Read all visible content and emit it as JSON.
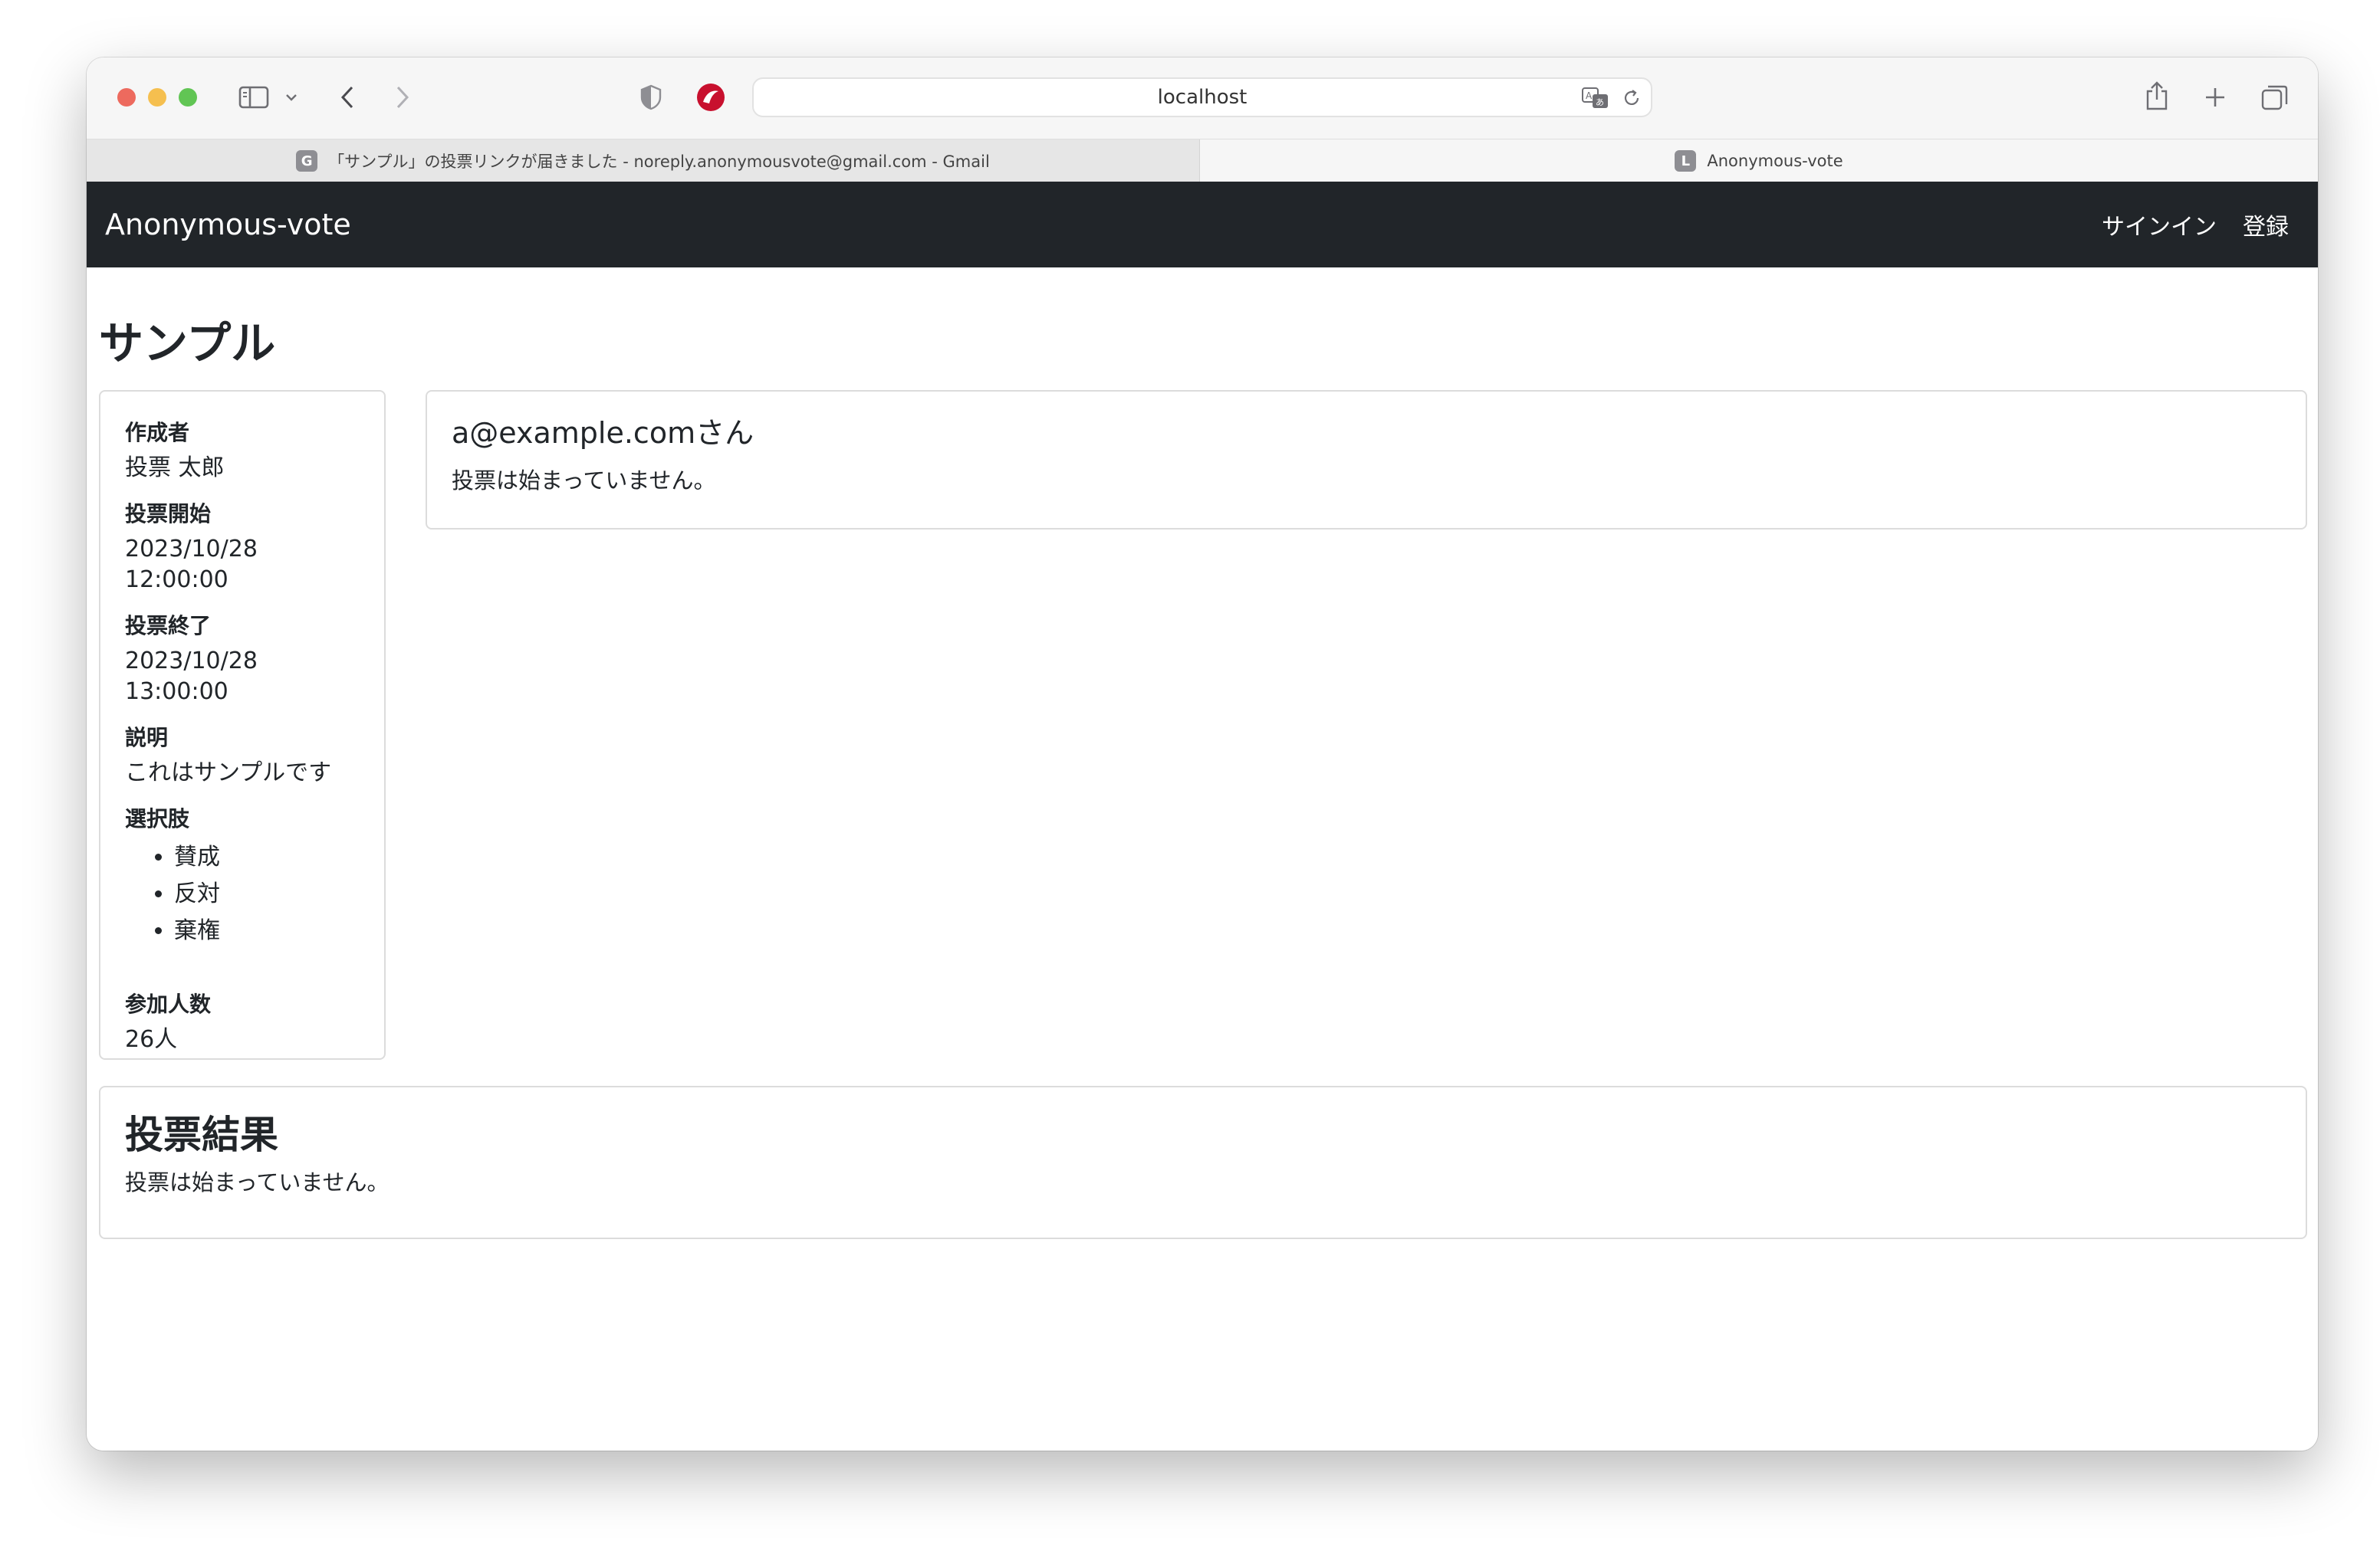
{
  "browser": {
    "url": "localhost",
    "tabs": [
      {
        "favicon": "G",
        "label": "「サンプル」の投票リンクが届きました - noreply.anonymousvote@gmail.com - Gmail",
        "active": false
      },
      {
        "favicon": "L",
        "label": "Anonymous-vote",
        "active": true
      }
    ],
    "icons": [
      "sidebar-icon",
      "chevron-down-icon",
      "back-icon",
      "forward-icon",
      "shield-icon",
      "extension-icon",
      "translate-icon",
      "reload-icon",
      "share-icon",
      "new-tab-icon",
      "tab-overview-icon"
    ],
    "traffic_colors": {
      "close": "#ed6a5e",
      "minimize": "#f5bf4f",
      "zoom": "#61c554"
    }
  },
  "navbar": {
    "brand": "Anonymous-vote",
    "links": [
      "サインイン",
      "登録"
    ],
    "background": "#212529"
  },
  "page": {
    "title": "サンプル"
  },
  "info": {
    "creator_label": "作成者",
    "creator_value": "投票 太郎",
    "start_label": "投票開始",
    "start_value": "2023/10/28 12:00:00",
    "end_label": "投票終了",
    "end_value": "2023/10/28 13:00:00",
    "description_label": "説明",
    "description_value": "これはサンプルです",
    "choices_label": "選択肢",
    "choices": [
      "賛成",
      "反対",
      "棄権"
    ],
    "participants_label": "参加人数",
    "participants_value": "26人"
  },
  "user_card": {
    "title": "a@example.comさん",
    "message": "投票は始まっていません。"
  },
  "result_card": {
    "title": "投票結果",
    "message": "投票は始まっていません。"
  }
}
